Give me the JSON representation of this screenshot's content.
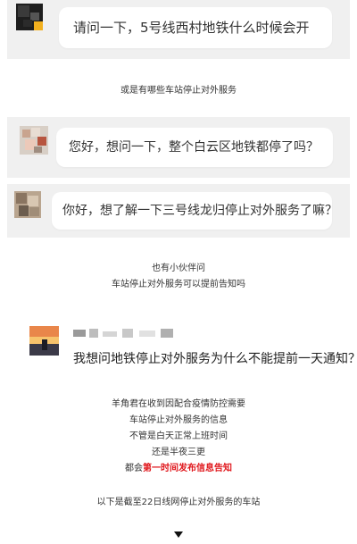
{
  "messages": [
    {
      "text": "请问一下，5号线西村地铁什么时候会开"
    },
    {
      "text": "您好，想问一下，整个白云区地铁都停了吗？"
    },
    {
      "text": "你好，想了解一下三号线龙归停止对外服务了嘛？"
    }
  ],
  "caption_1": "或是有哪些车站停止对外服务",
  "caption_2": [
    "也有小伙伴问",
    "车站停止对外服务可以提前告知吗"
  ],
  "comment": {
    "text": "我想问地铁停止对外服务为什么不能提前一天通知？"
  },
  "reply_lines": [
    "羊角君在收到因配合疫情防控需要",
    "车站停止对外服务的信息",
    "不管是白天正常上班时间",
    "还是半夜三更"
  ],
  "reply_emphasis": {
    "prefix": "都会",
    "highlight": "第一时间发布信息告知"
  },
  "footer_text": "以下是截至22日线网停止对外服务的车站",
  "colors": {
    "card_bg": "#f0f0f0",
    "highlight_red": "#e0161b"
  },
  "icons": {
    "down_arrow": "down-triangle-icon"
  }
}
